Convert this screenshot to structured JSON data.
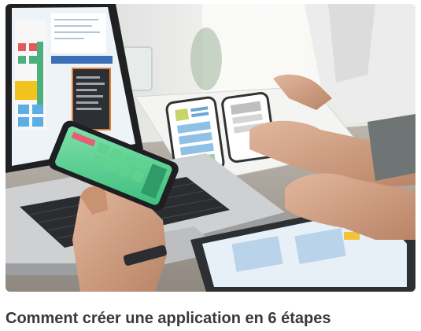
{
  "article": {
    "title": "Comment créer une application en 6 étapes"
  }
}
